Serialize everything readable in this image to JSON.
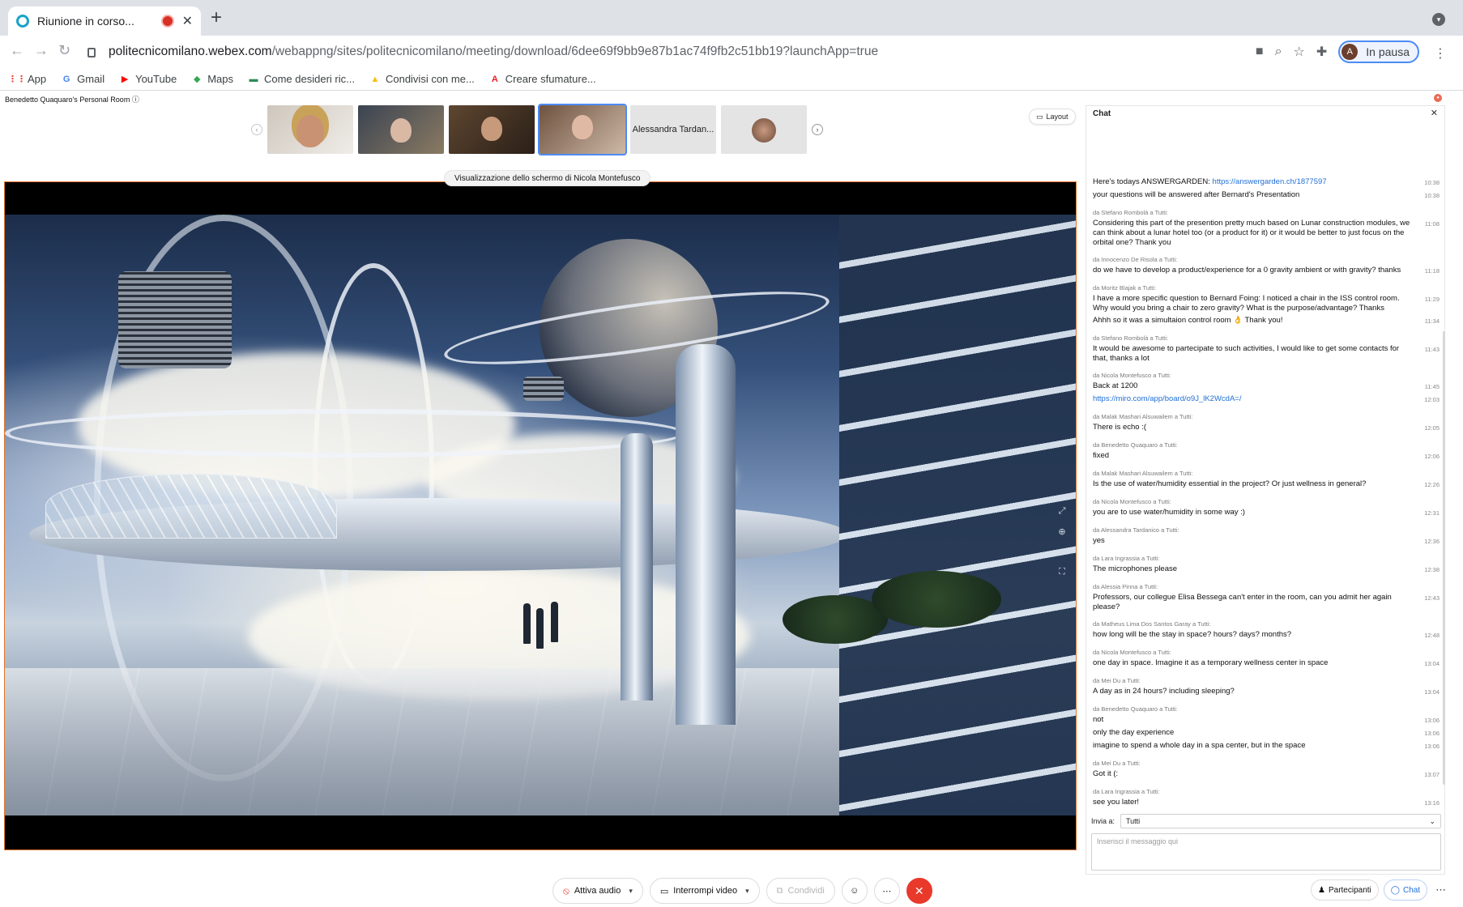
{
  "browser": {
    "tab_title": "Riunione in corso...",
    "new_tab": "+",
    "url_domain": "politecnicomilano.webex.com",
    "url_rest": "/webappng/sites/politecnicomilano/meeting/download/6dee69f9bb9e87b1ac74f9fb2c51bb19?launchApp=true",
    "profile_initial": "A",
    "profile_label": "In pausa",
    "bookmarks": [
      {
        "label": "App",
        "icon": "apps-grid-icon"
      },
      {
        "label": "Gmail",
        "icon": "google-icon"
      },
      {
        "label": "YouTube",
        "icon": "youtube-icon"
      },
      {
        "label": "Maps",
        "icon": "maps-icon"
      },
      {
        "label": "Come desideri ric...",
        "icon": "flag-icon"
      },
      {
        "label": "Condivisi con me...",
        "icon": "drive-icon"
      },
      {
        "label": "Creare sfumature...",
        "icon": "adobe-icon"
      }
    ]
  },
  "meeting": {
    "room_name": "Benedetto Quaquaro's Personal Room",
    "layout_label": "Layout",
    "named_thumb": "Alessandra Tardan...",
    "share_prefix": "Visualizzazione dello schermo di",
    "share_name": "Nicola Montefusco"
  },
  "controls": {
    "audio": "Attiva audio",
    "video": "Interrompi video",
    "share": "Condividi",
    "participants": "Partecipanti",
    "chat": "Chat"
  },
  "chat": {
    "title": "Chat",
    "send_to_label": "Invia a:",
    "send_to_value": "Tutti",
    "input_placeholder": "Inserisci il messaggio qui",
    "groups": [
      {
        "sender": "",
        "lines": [
          {
            "text": "Here's todays ANSWERGARDEN:",
            "link": "https://answergarden.ch/1877597",
            "time": "10:38"
          },
          {
            "text": "your questions will be answered after Bernard's Presentation",
            "link": "",
            "time": "10:38"
          }
        ]
      },
      {
        "sender": "da Stefano Rombolà a Tutti:",
        "lines": [
          {
            "text": "Considering this part of the presention pretty much based on Lunar construction modules, we can think about a lunar hotel too (or a product for it) or it would be better to just focus on the orbital one? Thank you",
            "link": "",
            "time": "11:08"
          }
        ]
      },
      {
        "sender": "da Innocenzo De Risola a Tutti:",
        "lines": [
          {
            "text": "do we have to develop a product/experience for a 0 gravity ambient or with gravity? thanks",
            "link": "",
            "time": "11:18"
          }
        ]
      },
      {
        "sender": "da Moritz Blajak a Tutti:",
        "lines": [
          {
            "text": "I have a more specific question to Bernard Foing: I noticed a chair in the ISS control room. Why would you bring a chair to zero gravity? What is the purpose/advantage? Thanks",
            "link": "",
            "time": "11:29"
          },
          {
            "text": "Ahhh so it was a simultaion control room 👌 Thank you!",
            "link": "",
            "time": "11:34"
          }
        ]
      },
      {
        "sender": "da Stefano Rombolà a Tutti:",
        "lines": [
          {
            "text": "It would be awesome to partecipate to such activities, I would like to get some contacts for that, thanks a lot",
            "link": "",
            "time": "11:43"
          }
        ]
      },
      {
        "sender": "da Nicola Montefusco a Tutti:",
        "lines": [
          {
            "text": "Back at 1200",
            "link": "",
            "time": "11:45"
          },
          {
            "text": "",
            "link": "https://miro.com/app/board/o9J_lK2WcdA=/",
            "time": "12:03"
          }
        ]
      },
      {
        "sender": "da Malak Mashari Alsuwailem a Tutti:",
        "lines": [
          {
            "text": "There is echo :(",
            "link": "",
            "time": "12:05"
          }
        ]
      },
      {
        "sender": "da Benedetto Quaquaro a Tutti:",
        "lines": [
          {
            "text": "fixed",
            "link": "",
            "time": "12:06"
          }
        ]
      },
      {
        "sender": "da Malak Mashari Alsuwailem a Tutti:",
        "lines": [
          {
            "text": "Is the use of water/humidity essential in the project? Or just wellness in general?",
            "link": "",
            "time": "12:26"
          }
        ]
      },
      {
        "sender": "da Nicola Montefusco a Tutti:",
        "lines": [
          {
            "text": "you are to use water/humidity in some way :)",
            "link": "",
            "time": "12:31"
          }
        ]
      },
      {
        "sender": "da Alessandra Tardanico a Tutti:",
        "lines": [
          {
            "text": "yes",
            "link": "",
            "time": "12:36"
          }
        ]
      },
      {
        "sender": "da Lara Ingrassia a Tutti:",
        "lines": [
          {
            "text": "The microphones please",
            "link": "",
            "time": "12:38"
          }
        ]
      },
      {
        "sender": "da Alessia Pinna a Tutti:",
        "lines": [
          {
            "text": "Professors, our collegue Elisa Bessega can't enter in the room, can you admit her again please?",
            "link": "",
            "time": "12:43"
          }
        ]
      },
      {
        "sender": "da Matheus Lima Dos Santos Garay a Tutti:",
        "lines": [
          {
            "text": "how long will be the stay in space? hours? days? months?",
            "link": "",
            "time": "12:48"
          }
        ]
      },
      {
        "sender": "da Nicola Montefusco a Tutti:",
        "lines": [
          {
            "text": "one day in space. Imagine it as a temporary wellness center in space",
            "link": "",
            "time": "13:04"
          }
        ]
      },
      {
        "sender": "da Mei Du a Tutti:",
        "lines": [
          {
            "text": "A day as in 24 hours? including sleeping?",
            "link": "",
            "time": "13:04"
          }
        ]
      },
      {
        "sender": "da Benedetto Quaquaro a Tutti:",
        "lines": [
          {
            "text": "not",
            "link": "",
            "time": "13:06"
          },
          {
            "text": "only the day experience",
            "link": "",
            "time": "13:06"
          },
          {
            "text": "imagine to spend a whole day in a spa center, but in the space",
            "link": "",
            "time": "13:06"
          }
        ]
      },
      {
        "sender": "da Mei Du a Tutti:",
        "lines": [
          {
            "text": "Got it (:",
            "link": "",
            "time": "13:07"
          }
        ]
      },
      {
        "sender": "da Lara Ingrassia a Tutti:",
        "lines": [
          {
            "text": "see you later!",
            "link": "",
            "time": "13:16"
          }
        ]
      }
    ]
  },
  "colors": {
    "accent_blue": "#4c8bf5",
    "end_call_red": "#e8392b",
    "share_border": "#e2742b"
  }
}
